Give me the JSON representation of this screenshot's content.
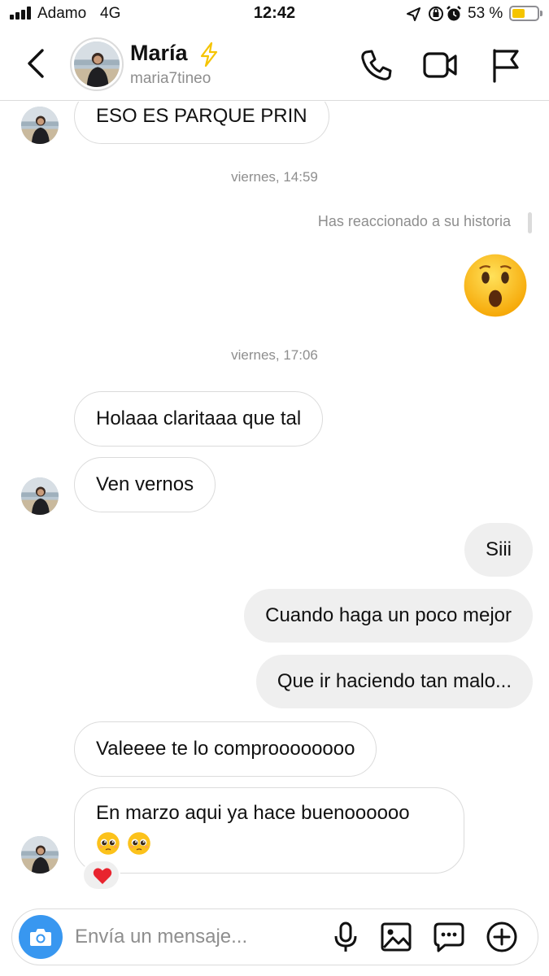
{
  "status_bar": {
    "carrier": "Adamo",
    "network": "4G",
    "time": "12:42",
    "battery_percent": "53 %",
    "battery_level": 0.53,
    "icons": [
      "location-icon",
      "orientation-lock-icon",
      "alarm-icon",
      "battery-icon"
    ],
    "battery_color": "#f5c400"
  },
  "header": {
    "name": "María",
    "username": "maria7tineo",
    "buttons": [
      "back-icon",
      "phone-icon",
      "video-icon",
      "flag-icon"
    ],
    "badge_icon": "bolt-icon",
    "badge_color": "#f5c400"
  },
  "messages": {
    "m1": "ESO ES PARQUE PRIN",
    "ts1": "viernes, 14:59",
    "story_reaction": "Has reaccionado a su historia",
    "story_emoji": "astonished-face-emoji",
    "ts2": "viernes, 17:06",
    "m2": "Holaaa claritaaa que tal",
    "m3": "Ven vernos",
    "m4": "Siii",
    "m5": "Cuando haga un poco mejor",
    "m6": "Que ir haciendo tan malo...",
    "m7": "Valeeee te lo comproooooooo",
    "m8_line1": "En marzo aqui ya hace buenoooooo",
    "m8_emojis": [
      "pleading-face-emoji",
      "pleading-face-emoji"
    ],
    "m8_reaction": "heart-emoji"
  },
  "composer": {
    "placeholder": "Envía un mensaje...",
    "buttons": [
      "camera-icon",
      "microphone-icon",
      "gallery-icon",
      "sticker-icon",
      "plus-icon"
    ],
    "accent": "#3897f0"
  }
}
